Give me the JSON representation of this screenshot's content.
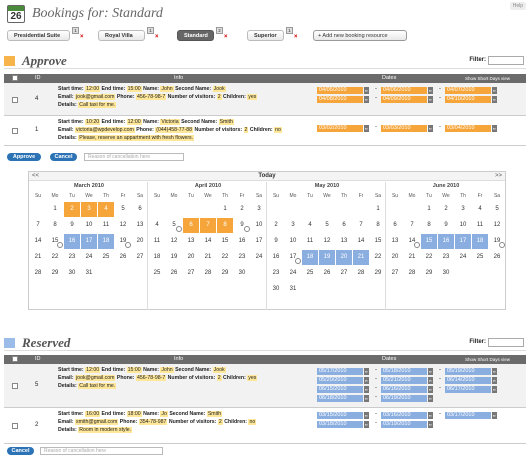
{
  "help": "Help",
  "calendar_icon_day": "26",
  "title": "Bookings for: Standard",
  "resources": [
    {
      "label": "Presidential Suite",
      "count": "1"
    },
    {
      "label": "Royal Villa",
      "count": "1"
    },
    {
      "label": "Standard",
      "count": "2"
    },
    {
      "label": "Superior",
      "count": "1"
    }
  ],
  "add_resource": "+ Add new booking resource",
  "approve": {
    "title": "Approve",
    "color": "#f6b44a",
    "filter": "Filter:"
  },
  "reserved": {
    "title": "Reserved",
    "color": "#9bbce8",
    "filter": "Filter:"
  },
  "table_header": {
    "id": "ID",
    "info": "Info",
    "dates": "Dates",
    "short": "Show Short Days view"
  },
  "approve_rows": [
    {
      "id": "4",
      "start": "12:00",
      "end": "15:00",
      "name": "John",
      "second": "Jook",
      "email": "jook@gmail.com",
      "phone": "456-78-98-7",
      "visitors": "2",
      "children": "yes",
      "details": "Call taxi for me.",
      "dates": [
        "04/05/2010",
        "04/06/2010",
        "04/07/2010",
        "04/08/2010",
        "04/09/2010",
        "04/10/2010"
      ]
    },
    {
      "id": "1",
      "start": "10:20",
      "end": "12:00",
      "name": "Victoria",
      "second": "Smith",
      "email": "victoria@wpdevelop.com",
      "phone": "(044)458-77-88",
      "visitors": "2",
      "children": "no",
      "details": "Please, reserve an appartment with fresh flowers.",
      "dates": [
        "03/02/2010",
        "03/03/2010",
        "03/04/2010"
      ]
    }
  ],
  "labels": {
    "start": "Start time:",
    "end": "End time:",
    "name": "Name:",
    "second": "Second Name:",
    "email": "Email:",
    "phone": "Phone:",
    "visitors": "Number of visitors:",
    "children": "Children:",
    "details": "Details:"
  },
  "approve_btn": "Approve",
  "cancel_btn": "Cancel",
  "reason_placeholder": "Reason of cancellation here",
  "cal": {
    "prev": "<<",
    "next": ">>",
    "today": "Today",
    "weekdays": [
      "Su",
      "Mo",
      "Tu",
      "We",
      "Th",
      "Fr",
      "Sa"
    ],
    "months": [
      {
        "name": "March 2010",
        "start": 1,
        "days": 31,
        "orange": [
          2,
          3,
          4
        ],
        "blue": [
          16,
          17,
          18
        ],
        "marks": [
          15,
          19
        ]
      },
      {
        "name": "April 2010",
        "start": 4,
        "days": 30,
        "orange": [
          6,
          7,
          8
        ],
        "blue": [],
        "marks": [
          5,
          9
        ]
      },
      {
        "name": "May 2010",
        "start": 6,
        "days": 31,
        "orange": [],
        "blue": [
          18,
          19,
          20,
          21
        ],
        "marks": [
          17
        ]
      },
      {
        "name": "June 2010",
        "start": 2,
        "days": 30,
        "orange": [],
        "blue": [
          15,
          16,
          17,
          18
        ],
        "marks": [
          14,
          19
        ]
      }
    ]
  },
  "reserved_rows": [
    {
      "id": "5",
      "start": "12:00",
      "end": "15:00",
      "name": "John",
      "second": "Jook",
      "email": "jook@gmail.com",
      "phone": "456-78-98-7",
      "visitors": "2",
      "children": "yes",
      "details": "Call taxi for me.",
      "dates": [
        "05/17/2010",
        "05/18/2010",
        "05/19/2010",
        "05/20/2010",
        "05/21/2010",
        "06/14/2010",
        "06/15/2010",
        "06/16/2010",
        "06/17/2010",
        "06/18/2010",
        "06/19/2010"
      ]
    },
    {
      "id": "2",
      "start": "16:00",
      "end": "18:00",
      "name": "Jo",
      "second": "Smith",
      "email": "smith@gmail.com",
      "phone": "354-78-987",
      "visitors": "2",
      "children": "no",
      "details": "Room in modern style.",
      "dates": [
        "03/15/2010",
        "03/16/2010",
        "03/17/2010",
        "03/18/2010",
        "03/19/2010"
      ]
    }
  ]
}
